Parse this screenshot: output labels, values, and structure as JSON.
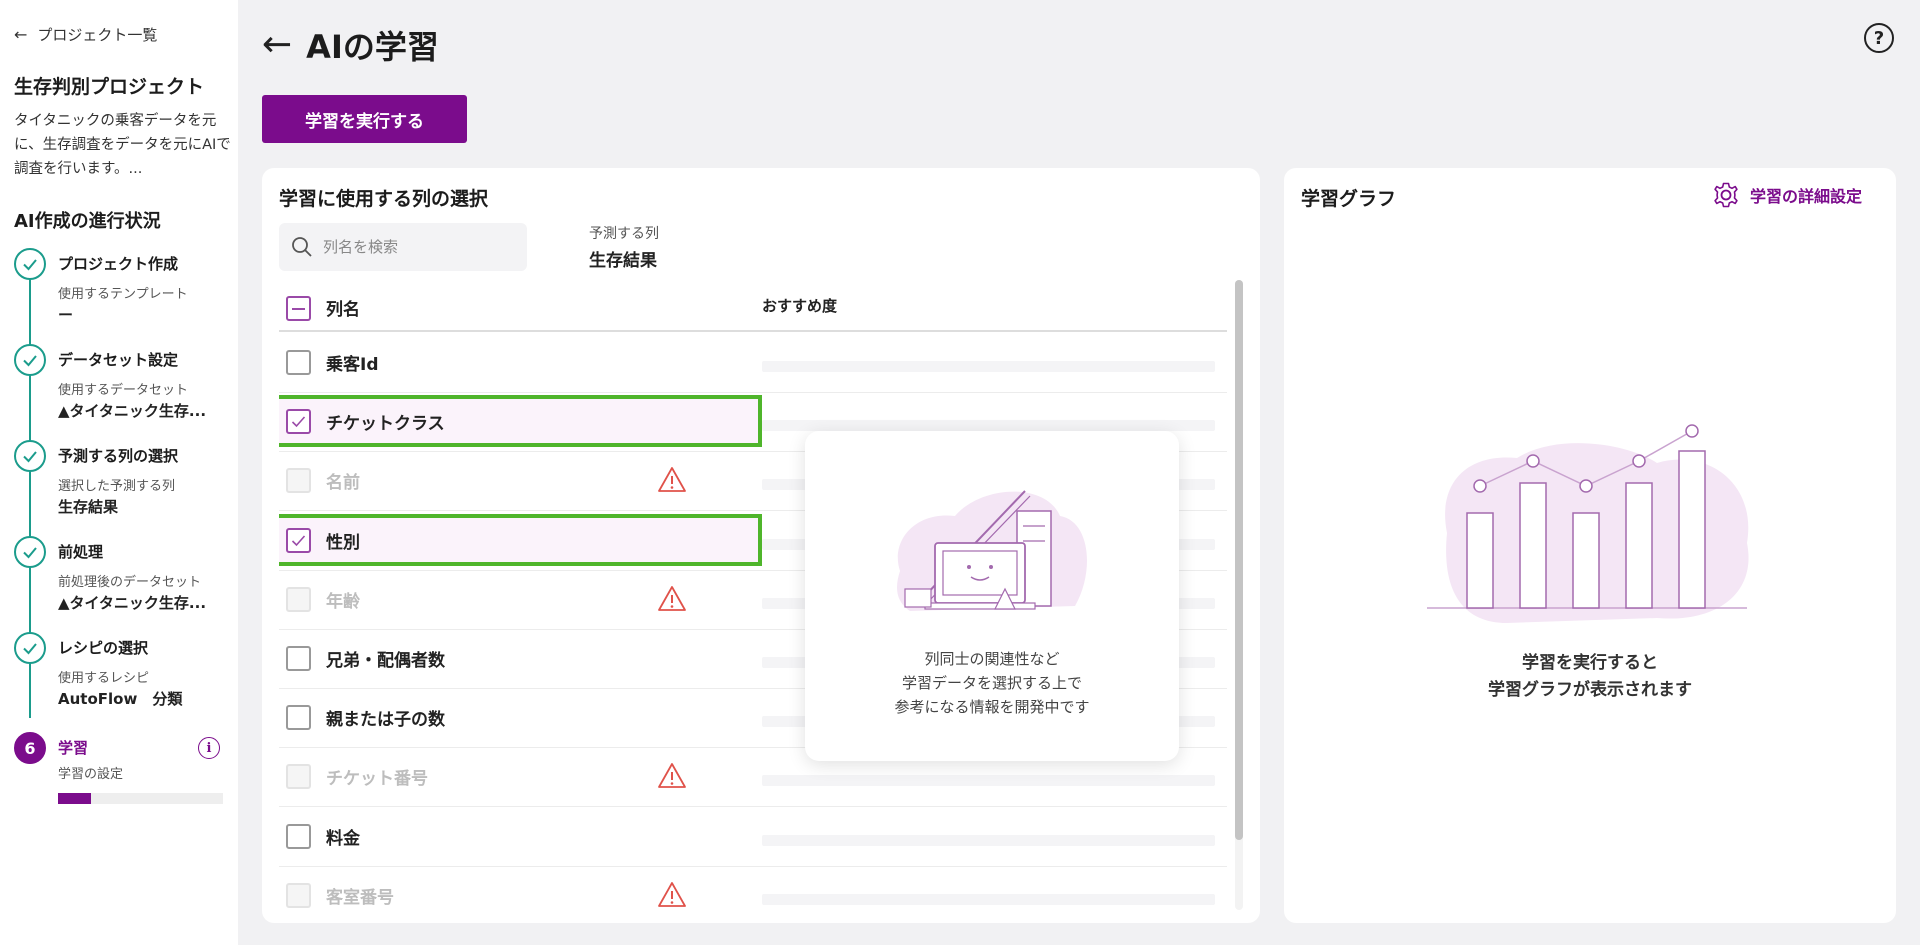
{
  "sidebar": {
    "back_label": "プロジェクト一覧",
    "project_title": "生存判別プロジェクト",
    "project_description": "タイタニックの乗客データを元に、生存調査をデータを元にAIで調査を行います。...",
    "progress_title": "AI作成の進行状況",
    "steps": [
      {
        "title": "プロジェクト作成",
        "sub": "使用するテンプレート",
        "value": "ー",
        "status": "done"
      },
      {
        "title": "データセット設定",
        "sub": "使用するデータセット",
        "value": "▲タイタニック生存...",
        "status": "done"
      },
      {
        "title": "予測する列の選択",
        "sub": "選択した予測する列",
        "value": "生存結果",
        "status": "done"
      },
      {
        "title": "前処理",
        "sub": "前処理後のデータセット",
        "value": "▲タイタニック生存...",
        "status": "done"
      },
      {
        "title": "レシピの選択",
        "sub": "使用するレシピ",
        "value": "AutoFlow　分類",
        "status": "done"
      },
      {
        "number": "6",
        "title": "学習",
        "sub": "学習の設定",
        "status": "active",
        "progress": 0.2
      }
    ]
  },
  "header": {
    "title": "AIの学習",
    "run_button": "学習を実行する"
  },
  "column_panel": {
    "title": "学習に使用する列の選択",
    "search_placeholder": "列名を検索",
    "target_label": "予測する列",
    "target_value": "生存結果",
    "col_name_header": "列名",
    "recommend_header": "おすすめ度",
    "rows": [
      {
        "name": "乗客Id",
        "checked": false,
        "disabled": false,
        "warning": false
      },
      {
        "name": "チケットクラス",
        "checked": true,
        "disabled": false,
        "warning": false
      },
      {
        "name": "名前",
        "checked": false,
        "disabled": true,
        "warning": true
      },
      {
        "name": "性別",
        "checked": true,
        "disabled": false,
        "warning": false
      },
      {
        "name": "年齢",
        "checked": false,
        "disabled": true,
        "warning": true
      },
      {
        "name": "兄弟・配偶者数",
        "checked": false,
        "disabled": false,
        "warning": false
      },
      {
        "name": "親または子の数",
        "checked": false,
        "disabled": false,
        "warning": false
      },
      {
        "name": "チケット番号",
        "checked": false,
        "disabled": true,
        "warning": true
      },
      {
        "name": "料金",
        "checked": false,
        "disabled": false,
        "warning": false
      },
      {
        "name": "客室番号",
        "checked": false,
        "disabled": true,
        "warning": true
      }
    ],
    "popup_message": [
      "列同士の関連性など",
      "学習データを選択する上で",
      "参考になる情報を開発中です"
    ]
  },
  "graph_panel": {
    "title": "学習グラフ",
    "settings_link": "学習の詳細設定",
    "empty_message": [
      "学習を実行すると",
      "学習グラフが表示されます"
    ]
  },
  "colors": {
    "accent": "#7b0c8c",
    "step_done": "#1b9c8c",
    "highlight": "#4fb52b",
    "warning": "#e0524a"
  },
  "icons": {
    "back": "arrow-left-icon",
    "help": "question-circle-icon",
    "search": "search-icon",
    "check": "check-icon",
    "warning": "warning-triangle-icon",
    "settings": "gear-icon",
    "info": "info-icon"
  }
}
